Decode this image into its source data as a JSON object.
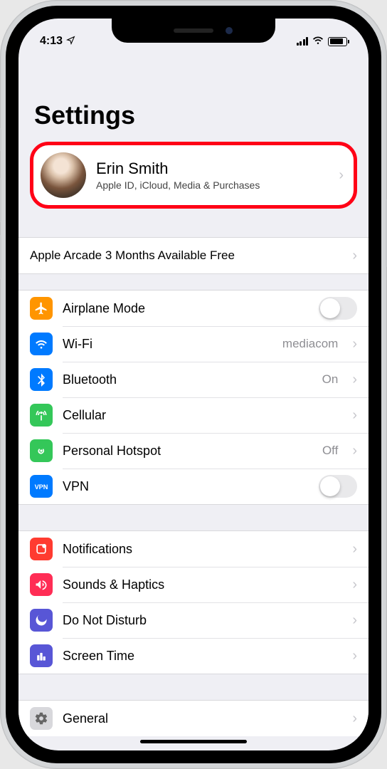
{
  "status": {
    "time": "4:13",
    "location_arrow": "➤"
  },
  "page_title": "Settings",
  "apple_id": {
    "name": "Erin Smith",
    "subtitle": "Apple ID, iCloud, Media & Purchases"
  },
  "promo": {
    "text": "Apple Arcade 3 Months Available Free"
  },
  "groups": [
    {
      "rows": [
        {
          "icon": "airplane",
          "color": "#ff9500",
          "label": "Airplane Mode",
          "accessory": "toggle"
        },
        {
          "icon": "wifi",
          "color": "#007aff",
          "label": "Wi-Fi",
          "value": "mediacom",
          "accessory": "chevron"
        },
        {
          "icon": "bluetooth",
          "color": "#007aff",
          "label": "Bluetooth",
          "value": "On",
          "accessory": "chevron"
        },
        {
          "icon": "cellular",
          "color": "#34c759",
          "label": "Cellular",
          "accessory": "chevron"
        },
        {
          "icon": "hotspot",
          "color": "#34c759",
          "label": "Personal Hotspot",
          "value": "Off",
          "accessory": "chevron"
        },
        {
          "icon": "vpn",
          "color": "#007aff",
          "label": "VPN",
          "accessory": "toggle"
        }
      ]
    },
    {
      "rows": [
        {
          "icon": "notifications",
          "color": "#ff3b30",
          "label": "Notifications",
          "accessory": "chevron"
        },
        {
          "icon": "sounds",
          "color": "#ff2d55",
          "label": "Sounds & Haptics",
          "accessory": "chevron"
        },
        {
          "icon": "dnd",
          "color": "#5856d6",
          "label": "Do Not Disturb",
          "accessory": "chevron"
        },
        {
          "icon": "screentime",
          "color": "#5856d6",
          "label": "Screen Time",
          "accessory": "chevron"
        }
      ]
    },
    {
      "rows": [
        {
          "icon": "general",
          "color": "#d8d8dc",
          "label": "General",
          "accessory": "chevron",
          "gray_icon": true
        }
      ]
    }
  ]
}
